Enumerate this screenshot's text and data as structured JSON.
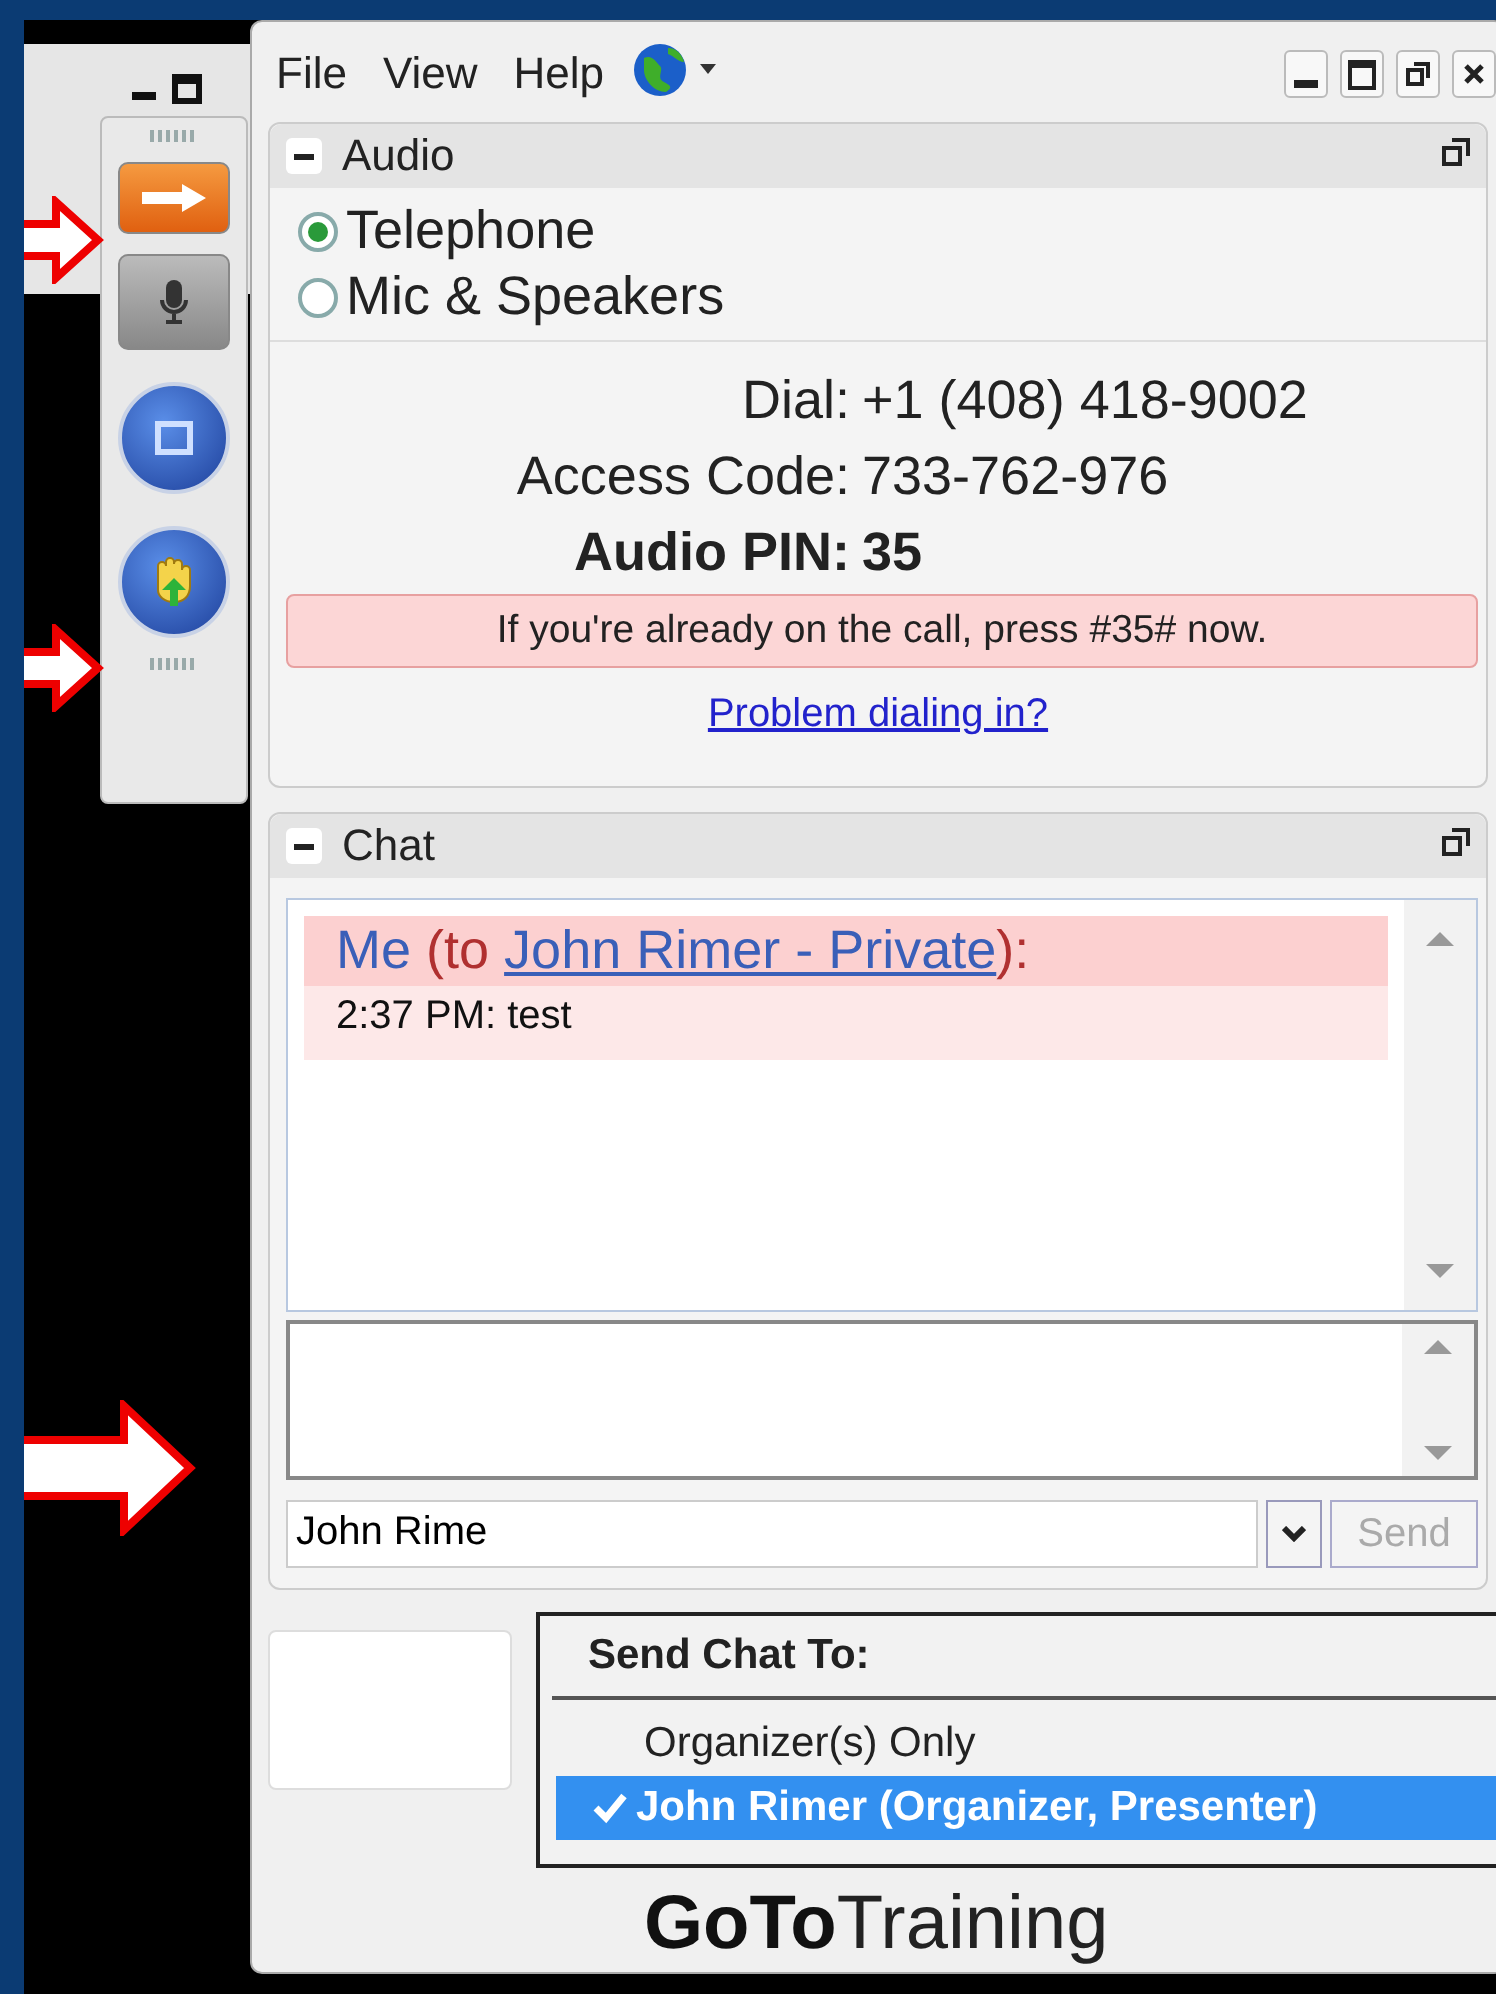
{
  "menu": [
    {
      "label": "File"
    },
    {
      "label": "View"
    },
    {
      "label": "Help"
    }
  ],
  "audio": {
    "title": "Audio",
    "options": [
      {
        "label": "Telephone",
        "selected": true
      },
      {
        "label": "Mic & Speakers",
        "selected": false
      }
    ],
    "details": [
      {
        "label": "Dial:",
        "value": "+1 (408) 418-9002",
        "kind": "normal"
      },
      {
        "label": "Access Code:",
        "value": "733-762-976",
        "kind": "normal"
      },
      {
        "label": "Audio PIN:",
        "value": "35",
        "kind": "bold"
      }
    ],
    "notice": "If you're already on the call, press #35# now.",
    "link": "Problem dialing in?"
  },
  "chat": {
    "title": "Chat",
    "messages": [
      {
        "sender": "Me",
        "before": "(to ",
        "recipient": "John Rimer - Private",
        "after": "):",
        "time": "2:37 PM:",
        "text": "test"
      }
    ],
    "recipient_value": "John Rime",
    "send_button": "Send"
  },
  "send_menu": {
    "title": "Send Chat To:",
    "items": [
      {
        "label": "Organizer(s) Only",
        "selected": false
      },
      {
        "label": "John Rimer (Organizer, Presenter)",
        "selected": true
      }
    ]
  },
  "logo": {
    "bold": "GoTo",
    "light": "Training"
  }
}
